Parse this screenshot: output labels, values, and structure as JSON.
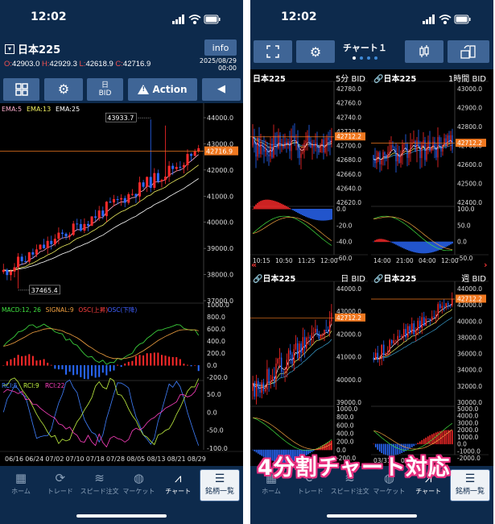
{
  "status": {
    "time": "12:02"
  },
  "left": {
    "symbol": "日本225",
    "info_label": "info",
    "ohlc": {
      "o_label": "O:",
      "o": "42903.0",
      "h_label": "H:",
      "h": "42929.3",
      "l_label": "L:",
      "l": "42618.9",
      "c_label": "C:",
      "c": "42716.9"
    },
    "date": "2025/08/29",
    "time": "00:00",
    "toolbar": {
      "day_label_1": "日",
      "day_label_2": "BID",
      "action_label": "Action"
    },
    "price_axis": [
      "44000.0",
      "43000.0",
      "42000.0",
      "41000.0",
      "40000.0",
      "39000.0",
      "38000.0",
      "37000.0"
    ],
    "current_price": "42716.9",
    "high_label": "43933.7",
    "low_label": "37465.4",
    "ema_labels": [
      {
        "text": "EMA:5",
        "color": "#ffb0d0"
      },
      {
        "text": "EMA:13",
        "color": "#f0f060"
      },
      {
        "text": "EMA:25",
        "color": "#ffffff"
      }
    ],
    "macd_labels": [
      {
        "text": "MACD:12, 26",
        "color": "#40e040"
      },
      {
        "text": "SIGNAL:9",
        "color": "#f0a040"
      },
      {
        "text": "OSC(上昇)",
        "color": "#ff4040"
      },
      {
        "text": "OSC(下降)",
        "color": "#4060ff"
      }
    ],
    "macd_axis": [
      "1000.0",
      "800.0",
      "600.0",
      "400.0",
      "200.0",
      "0.0",
      "-200.0"
    ],
    "rci_labels": [
      {
        "text": "RCI:5",
        "color": "#4080ff"
      },
      {
        "text": "RCI:9",
        "color": "#c0f040"
      },
      {
        "text": "RCI:22",
        "color": "#ff40c0"
      }
    ],
    "rci_axis": [
      "50.0",
      "0.0",
      "-50.0",
      "-100.0"
    ],
    "dates": [
      "06/16",
      "06/24",
      "07/02",
      "07/10",
      "07/18",
      "07/28",
      "08/05",
      "08/13",
      "08/21",
      "08/29"
    ]
  },
  "right": {
    "title": "チャート１",
    "quads": [
      {
        "symbol": "日本225",
        "tf": "5分 BID",
        "axis": [
          "42780.0",
          "42760.0",
          "42740.0",
          "42720.0",
          "42700.0",
          "42680.0",
          "42660.0",
          "42640.0",
          "42620.0"
        ],
        "price": "42712.2",
        "osc_axis": [
          "0.0",
          "-20.0",
          "-40.0",
          "-60.0"
        ],
        "dates": [
          "10:15",
          "10:50",
          "11:25",
          "12:00"
        ]
      },
      {
        "symbol": "日本225",
        "tf": "1時間 BID",
        "axis": [
          "43000.0",
          "42900.0",
          "42800.0",
          "42700.0",
          "42600.0",
          "42500.0",
          "42400.0"
        ],
        "price": "42712.2",
        "osc_axis": [
          "100.0",
          "50.0",
          "0.0",
          "-50.0"
        ],
        "dates": [
          "14:00",
          "21:00",
          "04:00",
          "12:00"
        ]
      },
      {
        "symbol": "日本225",
        "tf": "日 BID",
        "axis": [
          "44000.0",
          "43000.0",
          "42000.0",
          "41000.0",
          "40000.0",
          "39000.0"
        ],
        "price": "42712.2",
        "osc_axis": [
          "1000.0",
          "800.0",
          "600.0",
          "400.0",
          "200.0",
          "0.0",
          "-200.0"
        ],
        "dates": []
      },
      {
        "symbol": "日本225",
        "tf": "週 BID",
        "axis": [
          "44000.0",
          "42000.0",
          "40000.0",
          "38000.0",
          "36000.0",
          "34000.0",
          "32000.0",
          "30000.0"
        ],
        "price": "42712.2",
        "osc_axis": [
          "5000.0",
          "4000.0",
          "3000.0",
          "2000.0",
          "1000.0",
          "0.0",
          "-1000.0",
          "-2000.0"
        ],
        "dates": [
          "03/31",
          "05/12"
        ]
      }
    ]
  },
  "tabs": [
    {
      "label": "ホーム",
      "icon": "▦"
    },
    {
      "label": "トレード",
      "icon": "⟳"
    },
    {
      "label": "スピード注文",
      "icon": "≋"
    },
    {
      "label": "マーケット",
      "icon": "◍"
    },
    {
      "label": "チャート",
      "icon": "⩘"
    }
  ],
  "list_tab": {
    "label": "銘柄一覧",
    "icon": "☰"
  },
  "banner": "4分割チャート対応",
  "colors": {
    "up": "#ff2a2a",
    "down": "#2a6aff",
    "navy": "#0d2a4c",
    "button": "#3f6596",
    "price_tag": "#f07820"
  }
}
